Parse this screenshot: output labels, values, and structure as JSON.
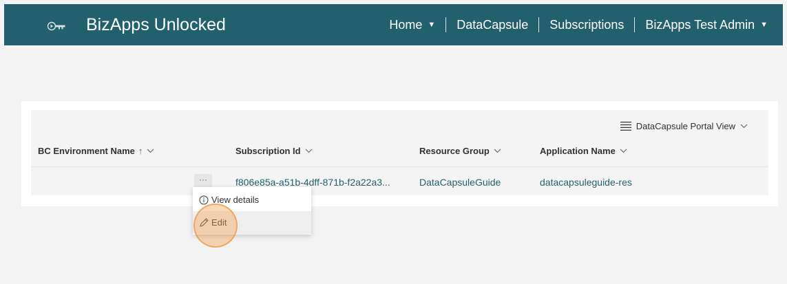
{
  "header": {
    "brand": "BizApps Unlocked",
    "logo_icon": "logo-key-icon",
    "nav": [
      {
        "label": "Home",
        "has_dropdown": true
      },
      {
        "label": "DataCapsule",
        "has_dropdown": false
      },
      {
        "label": "Subscriptions",
        "has_dropdown": false
      },
      {
        "label": "BizApps Test Admin",
        "has_dropdown": true
      }
    ],
    "caret_glyph": "▼"
  },
  "toolbar": {
    "view_label": "DataCapsule Portal View"
  },
  "table": {
    "columns": [
      {
        "label": "BC Environment Name",
        "sort_indicator": "↑"
      },
      {
        "label": "Subscription Id"
      },
      {
        "label": "Resource Group"
      },
      {
        "label": "Application Name"
      }
    ],
    "rows": [
      {
        "bc_environment_name": "",
        "more_label": "···",
        "subscription_id": "f806e85a-a51b-4dff-871b-f2a22a3...",
        "resource_group": "DataCapsuleGuide",
        "application_name": "datacapsuleguide-res"
      }
    ]
  },
  "context_menu": {
    "items": [
      {
        "label": "View details",
        "icon": "info-icon"
      },
      {
        "label": "Edit",
        "icon": "pencil-icon"
      }
    ]
  },
  "colors": {
    "header_bg": "#23606e",
    "link": "#23606e",
    "highlight": "#f6a456"
  }
}
